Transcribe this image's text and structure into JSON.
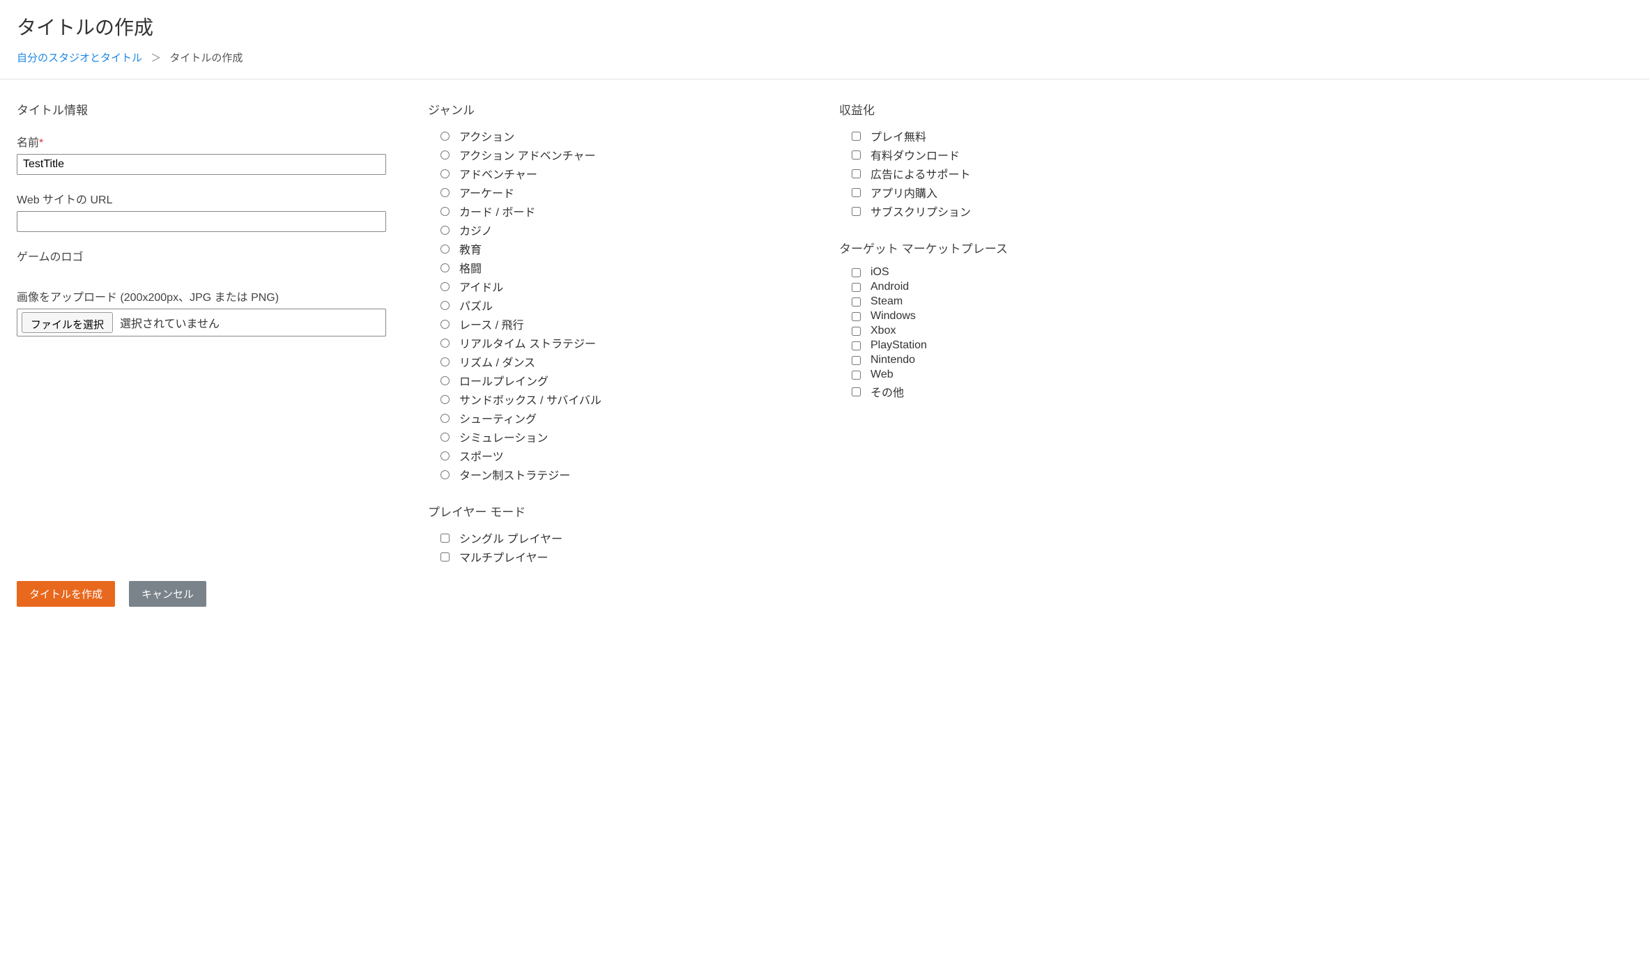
{
  "header": {
    "title": "タイトルの作成",
    "breadcrumb_link": "自分のスタジオとタイトル",
    "breadcrumb_sep": "＞",
    "breadcrumb_current": "タイトルの作成"
  },
  "left": {
    "section_title": "タイトル情報",
    "name_label": "名前",
    "name_value": "TestTitle",
    "url_label": "Web サイトの URL",
    "url_value": "",
    "logo_label": "ゲームのロゴ",
    "upload_label": "画像をアップロード (200x200px、JPG または PNG)",
    "file_button": "ファイルを選択",
    "file_status": "選択されていません"
  },
  "mid": {
    "genre_title": "ジャンル",
    "genres": [
      "アクション",
      "アクション アドベンチャー",
      "アドベンチャー",
      "アーケード",
      "カード / ボード",
      "カジノ",
      "教育",
      "格闘",
      "アイドル",
      "パズル",
      "レース / 飛行",
      "リアルタイム ストラテジー",
      "リズム / ダンス",
      "ロールプレイング",
      "サンドボックス / サバイバル",
      "シューティング",
      "シミュレーション",
      "スポーツ",
      "ターン制ストラテジー"
    ],
    "player_mode_title": "プレイヤー モード",
    "player_modes": [
      "シングル プレイヤー",
      "マルチプレイヤー"
    ]
  },
  "right": {
    "monetization_title": "収益化",
    "monetization": [
      "プレイ無料",
      "有料ダウンロード",
      "広告によるサポート",
      "アプリ内購入",
      "サブスクリプション"
    ],
    "marketplace_title": "ターゲット マーケットプレース",
    "marketplaces": [
      "iOS",
      "Android",
      "Steam",
      "Windows",
      "Xbox",
      "PlayStation",
      "Nintendo",
      "Web",
      "その他"
    ]
  },
  "footer": {
    "create": "タイトルを作成",
    "cancel": "キャンセル"
  }
}
